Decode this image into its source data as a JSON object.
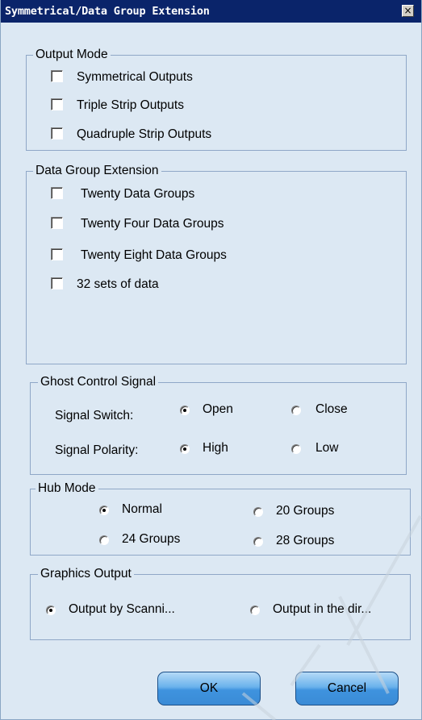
{
  "window": {
    "title": "Symmetrical/Data Group Extension",
    "close_glyph": "×"
  },
  "output_mode": {
    "legend": "Output Mode",
    "options": [
      {
        "label": "Symmetrical Outputs",
        "checked": false
      },
      {
        "label": "Triple Strip Outputs",
        "checked": false
      },
      {
        "label": "Quadruple Strip Outputs",
        "checked": false
      }
    ]
  },
  "data_group_extension": {
    "legend": "Data Group Extension",
    "options": [
      {
        "label": "Twenty Data Groups",
        "checked": false
      },
      {
        "label": "Twenty Four Data Groups",
        "checked": false
      },
      {
        "label": "Twenty Eight Data Groups",
        "checked": false
      },
      {
        "label": "32 sets of data",
        "checked": false
      }
    ]
  },
  "ghost_control": {
    "legend": "Ghost Control Signal",
    "switch_label": "Signal Switch:",
    "switch_open": "Open",
    "switch_close": "Close",
    "switch_selected": "Open",
    "polarity_label": "Signal Polarity:",
    "polarity_high": "High",
    "polarity_low": "Low",
    "polarity_selected": "High"
  },
  "hub_mode": {
    "legend": "Hub Mode",
    "normal": "Normal",
    "g20": "20 Groups",
    "g24": "24 Groups",
    "g28": "28 Groups",
    "selected": "Normal"
  },
  "graphics_output": {
    "legend": "Graphics Output",
    "by_scanning": "Output by Scanni...",
    "in_direction": "Output in the dir...",
    "selected": "Output by Scanni..."
  },
  "buttons": {
    "ok": "OK",
    "cancel": "Cancel"
  },
  "colors": {
    "titlebar": "#0a246a",
    "dialog_bg": "#dce8f3",
    "group_border": "#8fa7c7",
    "button_blue": "#3f93de"
  }
}
